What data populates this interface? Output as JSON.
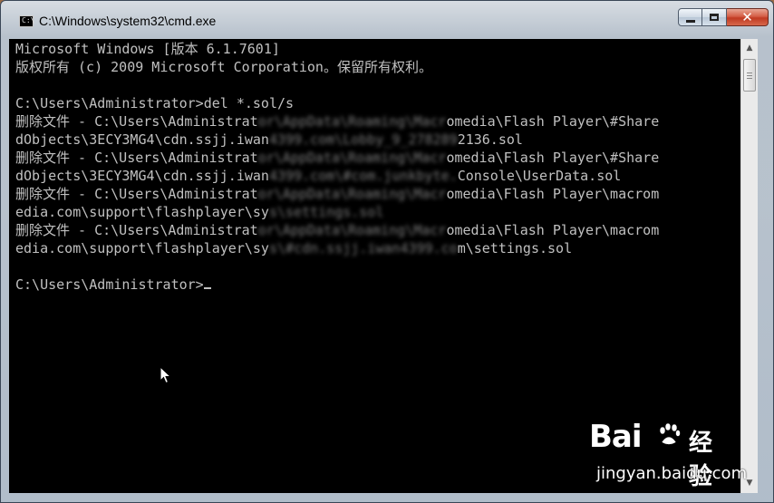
{
  "window": {
    "title": "C:\\Windows\\system32\\cmd.exe",
    "icon_label": "C:\\"
  },
  "controls": {
    "minimize": "minimize-icon",
    "maximize": "maximize-icon",
    "close": "close-icon",
    "close_glyph": "✕"
  },
  "console": {
    "lines": [
      {
        "text": "Microsoft Windows [版本 6.1.7601]"
      },
      {
        "text": "版权所有 (c) 2009 Microsoft Corporation。保留所有权利。"
      },
      {
        "text": ""
      },
      {
        "text": "C:\\Users\\Administrator>del *.sol/s"
      },
      {
        "pre": "删除文件 - C:\\Users\\Administrat",
        "blur": "or\\AppData\\Roaming\\Macr",
        "post": "omedia\\Flash Player\\#Share"
      },
      {
        "pre": "dObjects\\3ECY3MG4\\cdn.ssjj.iwan",
        "blur": "4399.com\\Lobby_9_278289",
        "post": "2136.sol"
      },
      {
        "pre": "删除文件 - C:\\Users\\Administrat",
        "blur": "or\\AppData\\Roaming\\Macr",
        "post": "omedia\\Flash Player\\#Share"
      },
      {
        "pre": "dObjects\\3ECY3MG4\\cdn.ssjj.iwan",
        "blur": "4399.com\\#com.junkbyte.",
        "post": "Console\\UserData.sol"
      },
      {
        "pre": "删除文件 - C:\\Users\\Administrat",
        "blur": "or\\AppData\\Roaming\\Macr",
        "post": "omedia\\Flash Player\\macrom"
      },
      {
        "pre": "edia.com\\support\\flashplayer\\sy",
        "blur": "s\\settings.sol",
        "post": ""
      },
      {
        "pre": "删除文件 - C:\\Users\\Administrat",
        "blur": "or\\AppData\\Roaming\\Macr",
        "post": "omedia\\Flash Player\\macrom"
      },
      {
        "pre": "edia.com\\support\\flashplayer\\sy",
        "blur": "s\\#cdn.ssjj.iwan4399.co",
        "post": "m\\settings.sol"
      },
      {
        "text": ""
      },
      {
        "text": "C:\\Users\\Administrator>"
      }
    ]
  },
  "scrollbar": {
    "up": "▲",
    "down": "▼"
  },
  "watermark": {
    "brand": "Bai",
    "brand_suffix": "经验",
    "url": "jingyan.baidu.com"
  }
}
